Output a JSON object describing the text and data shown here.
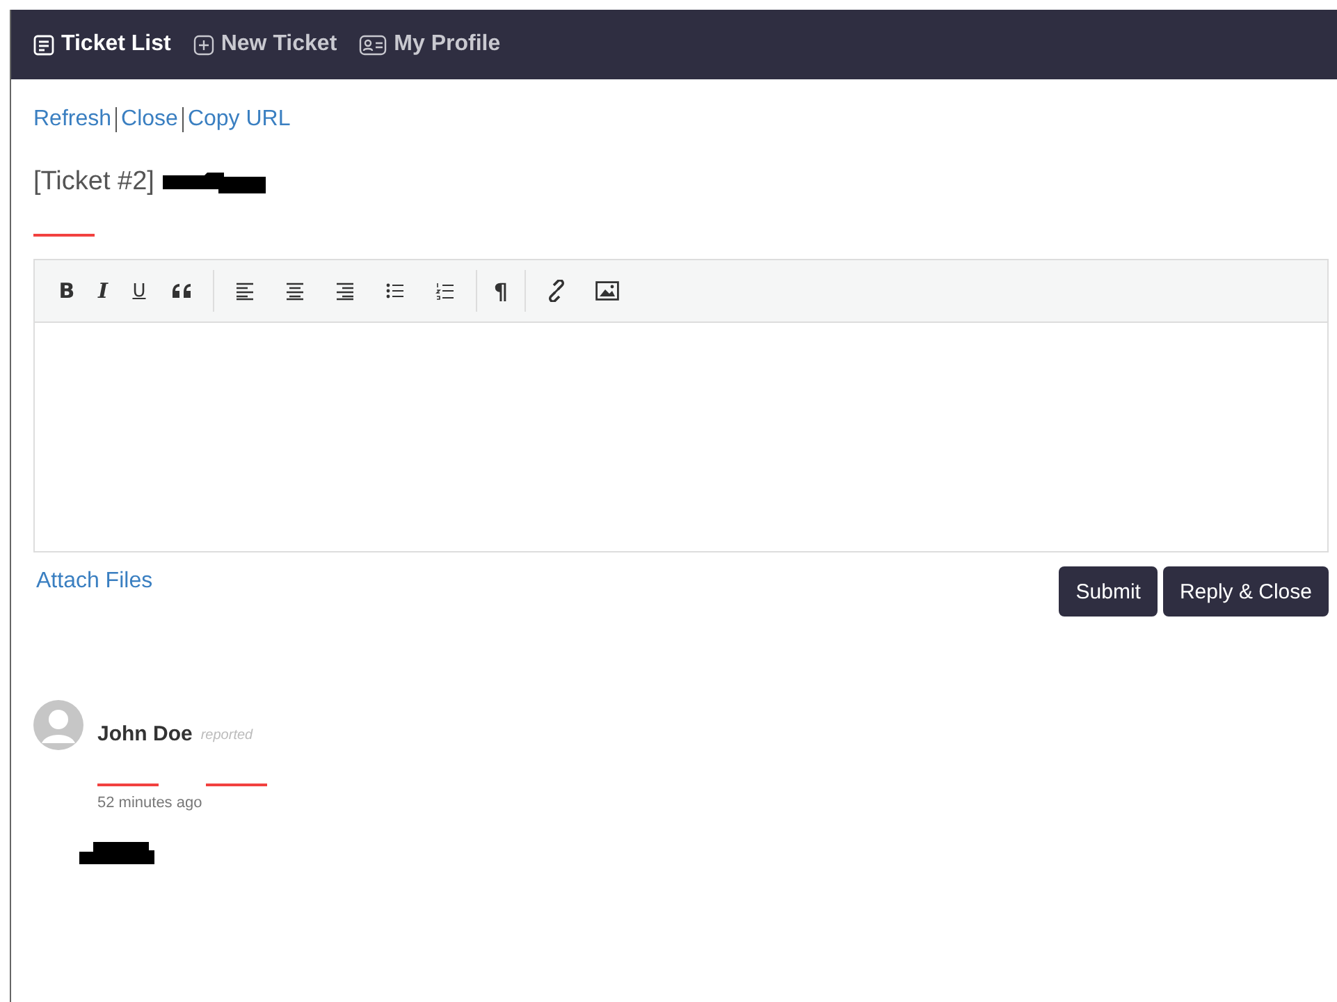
{
  "nav": {
    "tabs": [
      {
        "label": "Ticket List",
        "kind": "list",
        "selected": true
      },
      {
        "label": "New Ticket",
        "kind": "plus",
        "selected": false
      },
      {
        "label": "My Profile",
        "kind": "profile",
        "selected": false
      }
    ]
  },
  "actions": [
    "Refresh",
    "Close",
    "Copy URL"
  ],
  "ticket": {
    "title": "[Ticket #2]"
  },
  "editor": {
    "toolbar": [
      [
        {
          "kind": "bold",
          "label": "B"
        },
        {
          "kind": "italic",
          "label": "I"
        },
        {
          "kind": "underline",
          "label": "U"
        },
        {
          "kind": "quote"
        }
      ],
      [
        {
          "kind": "align-left"
        },
        {
          "kind": "align-center"
        },
        {
          "kind": "align-right"
        },
        {
          "kind": "bullet-list"
        },
        {
          "kind": "number-list"
        }
      ],
      [
        {
          "kind": "paragraph",
          "label": "¶"
        }
      ],
      [
        {
          "kind": "link"
        },
        {
          "kind": "image"
        }
      ]
    ]
  },
  "attach": "Attach Files",
  "buttons": [
    "Submit",
    "Reply & Close"
  ],
  "thread": [
    {
      "author": "John Doe",
      "action": "reported",
      "time": "52 minutes ago"
    }
  ]
}
